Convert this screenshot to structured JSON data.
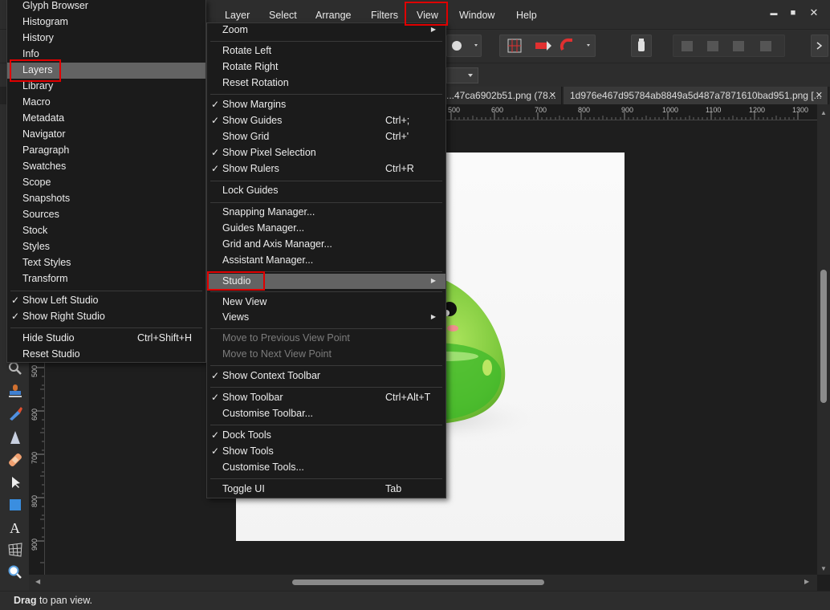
{
  "menubar": {
    "items": [
      "Layer",
      "Select",
      "Arrange",
      "Filters",
      "View",
      "Window",
      "Help"
    ],
    "window_controls": {
      "minimize": "▬",
      "maximize": "■",
      "close": "✕"
    }
  },
  "tabs": [
    "...47ca6902b51.png (78...",
    "1d976e467d95784ab8849a5d487a7871610bad951.png [..."
  ],
  "ruler": {
    "h_labels": [
      "500",
      "600",
      "700",
      "800",
      "900",
      "1000",
      "1100",
      "1200",
      "1300"
    ],
    "v_labels": [
      "500",
      "600",
      "700",
      "800",
      "900"
    ]
  },
  "studio_menu": {
    "panels": [
      "Glyph Browser",
      "Histogram",
      "History",
      "Info",
      "Layers",
      "Library",
      "Macro",
      "Metadata",
      "Navigator",
      "Paragraph",
      "Swatches",
      "Scope",
      "Snapshots",
      "Sources",
      "Stock",
      "Styles",
      "Text Styles",
      "Transform"
    ],
    "highlighted": "Layers",
    "show_left_studio": "Show Left Studio",
    "show_right_studio": "Show Right Studio",
    "hide_studio": "Hide Studio",
    "hide_studio_shortcut": "Ctrl+Shift+H",
    "reset_studio": "Reset Studio",
    "check_mark": "✓"
  },
  "view_menu": {
    "zoom": "Zoom",
    "rotate_left": "Rotate Left",
    "rotate_right": "Rotate Right",
    "reset_rotation": "Reset Rotation",
    "show_margins": "Show Margins",
    "show_guides": "Show Guides",
    "show_guides_shortcut": "Ctrl+;",
    "show_grid": "Show Grid",
    "show_grid_shortcut": "Ctrl+'",
    "show_pixel_selection": "Show Pixel Selection",
    "show_rulers": "Show Rulers",
    "show_rulers_shortcut": "Ctrl+R",
    "lock_guides": "Lock Guides",
    "snapping_manager": "Snapping Manager...",
    "guides_manager": "Guides Manager...",
    "grid_axis_manager": "Grid and Axis Manager...",
    "assistant_manager": "Assistant Manager...",
    "studio": "Studio",
    "new_view": "New View",
    "views": "Views",
    "move_prev_view_point": "Move to Previous View Point",
    "move_next_view_point": "Move to Next View Point",
    "show_context_toolbar": "Show Context Toolbar",
    "show_toolbar": "Show Toolbar",
    "show_toolbar_shortcut": "Ctrl+Alt+T",
    "customise_toolbar": "Customise Toolbar...",
    "dock_tools": "Dock Tools",
    "show_tools": "Show Tools",
    "customise_tools": "Customise Tools...",
    "toggle_ui": "Toggle UI",
    "toggle_ui_shortcut": "Tab"
  },
  "status": {
    "bold": "Drag",
    "text": "to pan view."
  }
}
